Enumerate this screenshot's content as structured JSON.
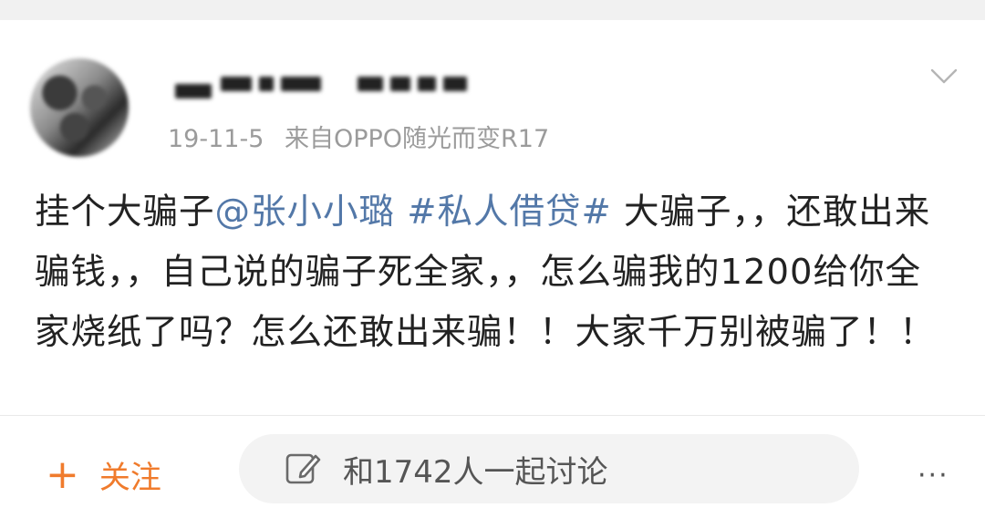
{
  "post": {
    "timestamp": "19-11-5",
    "source": "来自OPPO随光而变R17",
    "body": {
      "p1": "挂个大骗子",
      "mention": "@张小小璐",
      "hashtag": "#私人借贷#",
      "p2": " 大骗子，，还敢出来骗钱，，自己说的骗子死全家，，怎么骗我的1200给你全家烧纸了吗？怎么还敢出来骗！！大家千万别被骗了！！"
    },
    "icons": {
      "avatar": "blurred-avatar",
      "menu": "chevron-down-icon"
    }
  },
  "footer": {
    "follow_icon": "+",
    "follow_label": "关注",
    "discuss_label": "和1742人一起讨论",
    "more_label": "···"
  },
  "colors": {
    "link": "#5378a8",
    "follow": "#f07b2c",
    "meta": "#9b9b9b",
    "pill_bg": "#f3f3f3"
  }
}
